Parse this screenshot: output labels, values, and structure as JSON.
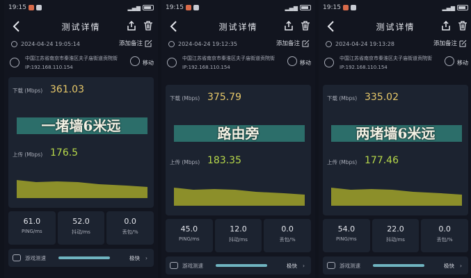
{
  "panels": [
    {
      "status_time": "19:15",
      "title": "测试详情",
      "datetime": "2024-04-24 19:05:14",
      "note_label": "添加备注",
      "location": "中国江苏省南京市秦淮区夫子庙街道贡院街",
      "ip": "IP:192.168.110.154",
      "carrier": "移动",
      "download_label": "下载 (Mbps)",
      "download_value": "361.03",
      "upload_label": "上传 (Mbps)",
      "upload_value": "176.5",
      "caption": "一堵墙6米远",
      "ping": "61.0",
      "ping_label": "PING/ms",
      "jitter": "52.0",
      "jitter_label": "抖动/ms",
      "loss": "0.0",
      "loss_label": "丢包/%",
      "game_label": "游戏测速",
      "game_quality": "极快"
    },
    {
      "status_time": "19:15",
      "title": "测试详情",
      "datetime": "2024-04-24 19:12:35",
      "note_label": "添加备注",
      "location": "中国江苏省南京市秦淮区夫子庙街道贡院街",
      "ip": "IP:192.168.110.154",
      "carrier": "移动",
      "download_label": "下载 (Mbps)",
      "download_value": "375.79",
      "upload_label": "上传 (Mbps)",
      "upload_value": "183.35",
      "caption": "路由旁",
      "ping": "45.0",
      "ping_label": "PING/ms",
      "jitter": "12.0",
      "jitter_label": "抖动/ms",
      "loss": "0.0",
      "loss_label": "丢包/%",
      "game_label": "游戏测速",
      "game_quality": "极快"
    },
    {
      "status_time": "19:15",
      "title": "测试详情",
      "datetime": "2024-04-24 19:13:28",
      "note_label": "添加备注",
      "location": "中国江苏省南京市秦淮区夫子庙街道贡院街",
      "ip": "IP:192.168.110.154",
      "carrier": "移动",
      "download_label": "下载 (Mbps)",
      "download_value": "335.02",
      "upload_label": "上传 (Mbps)",
      "upload_value": "177.46",
      "caption": "两堵墙6米远",
      "ping": "54.0",
      "ping_label": "PING/ms",
      "jitter": "22.0",
      "jitter_label": "抖动/ms",
      "loss": "0.0",
      "loss_label": "丢包/%",
      "game_label": "游戏测速",
      "game_quality": "极快"
    }
  ],
  "colors": {
    "download": "#e8c96a",
    "upload": "#b7d84a",
    "download_wave": "#2c6e6a",
    "upload_wave": "#8c8f2a"
  },
  "icons": [
    "back-arrow-icon",
    "share-icon",
    "trash-icon",
    "clock-icon",
    "edit-icon",
    "location-icon",
    "globe-icon",
    "gamepad-icon",
    "chevron-right-icon"
  ]
}
